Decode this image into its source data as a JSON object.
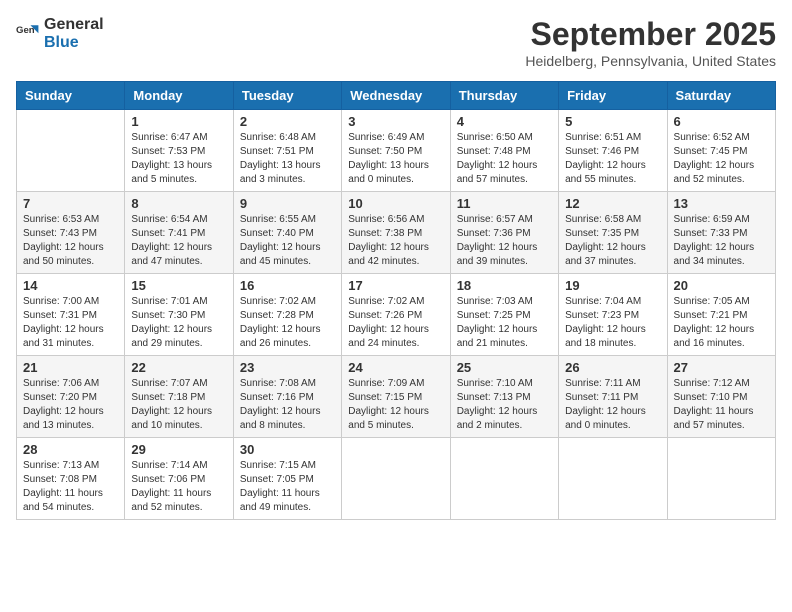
{
  "logo": {
    "general": "General",
    "blue": "Blue"
  },
  "title": {
    "month": "September 2025",
    "location": "Heidelberg, Pennsylvania, United States"
  },
  "headers": [
    "Sunday",
    "Monday",
    "Tuesday",
    "Wednesday",
    "Thursday",
    "Friday",
    "Saturday"
  ],
  "weeks": [
    [
      {
        "day": "",
        "info": ""
      },
      {
        "day": "1",
        "info": "Sunrise: 6:47 AM\nSunset: 7:53 PM\nDaylight: 13 hours\nand 5 minutes."
      },
      {
        "day": "2",
        "info": "Sunrise: 6:48 AM\nSunset: 7:51 PM\nDaylight: 13 hours\nand 3 minutes."
      },
      {
        "day": "3",
        "info": "Sunrise: 6:49 AM\nSunset: 7:50 PM\nDaylight: 13 hours\nand 0 minutes."
      },
      {
        "day": "4",
        "info": "Sunrise: 6:50 AM\nSunset: 7:48 PM\nDaylight: 12 hours\nand 57 minutes."
      },
      {
        "day": "5",
        "info": "Sunrise: 6:51 AM\nSunset: 7:46 PM\nDaylight: 12 hours\nand 55 minutes."
      },
      {
        "day": "6",
        "info": "Sunrise: 6:52 AM\nSunset: 7:45 PM\nDaylight: 12 hours\nand 52 minutes."
      }
    ],
    [
      {
        "day": "7",
        "info": "Sunrise: 6:53 AM\nSunset: 7:43 PM\nDaylight: 12 hours\nand 50 minutes."
      },
      {
        "day": "8",
        "info": "Sunrise: 6:54 AM\nSunset: 7:41 PM\nDaylight: 12 hours\nand 47 minutes."
      },
      {
        "day": "9",
        "info": "Sunrise: 6:55 AM\nSunset: 7:40 PM\nDaylight: 12 hours\nand 45 minutes."
      },
      {
        "day": "10",
        "info": "Sunrise: 6:56 AM\nSunset: 7:38 PM\nDaylight: 12 hours\nand 42 minutes."
      },
      {
        "day": "11",
        "info": "Sunrise: 6:57 AM\nSunset: 7:36 PM\nDaylight: 12 hours\nand 39 minutes."
      },
      {
        "day": "12",
        "info": "Sunrise: 6:58 AM\nSunset: 7:35 PM\nDaylight: 12 hours\nand 37 minutes."
      },
      {
        "day": "13",
        "info": "Sunrise: 6:59 AM\nSunset: 7:33 PM\nDaylight: 12 hours\nand 34 minutes."
      }
    ],
    [
      {
        "day": "14",
        "info": "Sunrise: 7:00 AM\nSunset: 7:31 PM\nDaylight: 12 hours\nand 31 minutes."
      },
      {
        "day": "15",
        "info": "Sunrise: 7:01 AM\nSunset: 7:30 PM\nDaylight: 12 hours\nand 29 minutes."
      },
      {
        "day": "16",
        "info": "Sunrise: 7:02 AM\nSunset: 7:28 PM\nDaylight: 12 hours\nand 26 minutes."
      },
      {
        "day": "17",
        "info": "Sunrise: 7:02 AM\nSunset: 7:26 PM\nDaylight: 12 hours\nand 24 minutes."
      },
      {
        "day": "18",
        "info": "Sunrise: 7:03 AM\nSunset: 7:25 PM\nDaylight: 12 hours\nand 21 minutes."
      },
      {
        "day": "19",
        "info": "Sunrise: 7:04 AM\nSunset: 7:23 PM\nDaylight: 12 hours\nand 18 minutes."
      },
      {
        "day": "20",
        "info": "Sunrise: 7:05 AM\nSunset: 7:21 PM\nDaylight: 12 hours\nand 16 minutes."
      }
    ],
    [
      {
        "day": "21",
        "info": "Sunrise: 7:06 AM\nSunset: 7:20 PM\nDaylight: 12 hours\nand 13 minutes."
      },
      {
        "day": "22",
        "info": "Sunrise: 7:07 AM\nSunset: 7:18 PM\nDaylight: 12 hours\nand 10 minutes."
      },
      {
        "day": "23",
        "info": "Sunrise: 7:08 AM\nSunset: 7:16 PM\nDaylight: 12 hours\nand 8 minutes."
      },
      {
        "day": "24",
        "info": "Sunrise: 7:09 AM\nSunset: 7:15 PM\nDaylight: 12 hours\nand 5 minutes."
      },
      {
        "day": "25",
        "info": "Sunrise: 7:10 AM\nSunset: 7:13 PM\nDaylight: 12 hours\nand 2 minutes."
      },
      {
        "day": "26",
        "info": "Sunrise: 7:11 AM\nSunset: 7:11 PM\nDaylight: 12 hours\nand 0 minutes."
      },
      {
        "day": "27",
        "info": "Sunrise: 7:12 AM\nSunset: 7:10 PM\nDaylight: 11 hours\nand 57 minutes."
      }
    ],
    [
      {
        "day": "28",
        "info": "Sunrise: 7:13 AM\nSunset: 7:08 PM\nDaylight: 11 hours\nand 54 minutes."
      },
      {
        "day": "29",
        "info": "Sunrise: 7:14 AM\nSunset: 7:06 PM\nDaylight: 11 hours\nand 52 minutes."
      },
      {
        "day": "30",
        "info": "Sunrise: 7:15 AM\nSunset: 7:05 PM\nDaylight: 11 hours\nand 49 minutes."
      },
      {
        "day": "",
        "info": ""
      },
      {
        "day": "",
        "info": ""
      },
      {
        "day": "",
        "info": ""
      },
      {
        "day": "",
        "info": ""
      }
    ]
  ]
}
